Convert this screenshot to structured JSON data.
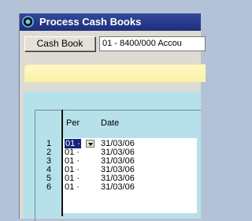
{
  "window": {
    "title": "Process Cash Books"
  },
  "toolbar": {
    "cash_book_label": "Cash Book",
    "cash_book_value": "01 -  8400/000 Accou"
  },
  "grid": {
    "headers": {
      "per": "Per",
      "date": "Date"
    },
    "rows": [
      {
        "num": "1",
        "per": "01 ·",
        "date": "31/03/06"
      },
      {
        "num": "2",
        "per": "01 ·",
        "date": "31/03/06"
      },
      {
        "num": "3",
        "per": "01 ·",
        "date": "31/03/06"
      },
      {
        "num": "4",
        "per": "01 ·",
        "date": "31/03/06"
      },
      {
        "num": "5",
        "per": "01 ·",
        "date": "31/03/06"
      },
      {
        "num": "6",
        "per": "01 ·",
        "date": "31/03/06"
      }
    ]
  },
  "colors": {
    "titlebar": "#1e2f7b",
    "grid_background": "#b6e1ea",
    "yellow_band": "#fbf1a4",
    "selection": "#15257a"
  },
  "icons": {
    "app": "app-icon"
  }
}
